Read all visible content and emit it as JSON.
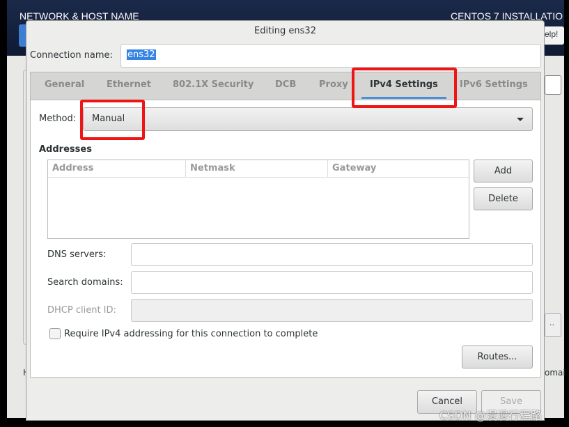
{
  "background": {
    "header_title": "NETWORK & HOST NAME",
    "header_right": "CENTOS 7 INSTALLATIO",
    "help_label": "elp!",
    "side_button_label": "..",
    "left_text": "H",
    "right_text": "omai"
  },
  "dialog": {
    "title": "Editing ens32",
    "connection_name_label": "Connection name:",
    "connection_name_value": "ens32",
    "tabs": [
      {
        "label": "General"
      },
      {
        "label": "Ethernet"
      },
      {
        "label": "802.1X Security"
      },
      {
        "label": "DCB"
      },
      {
        "label": "Proxy"
      },
      {
        "label": "IPv4 Settings",
        "active": true
      },
      {
        "label": "IPv6 Settings"
      }
    ],
    "method_label": "Method:",
    "method_value": "Manual",
    "addresses_label": "Addresses",
    "columns": [
      "Address",
      "Netmask",
      "Gateway"
    ],
    "add_label": "Add",
    "delete_label": "Delete",
    "dns_label": "DNS servers:",
    "dns_value": "",
    "search_label": "Search domains:",
    "search_value": "",
    "dhcp_label": "DHCP client ID:",
    "dhcp_value": "",
    "require_label": "Require IPv4 addressing for this connection to complete",
    "require_checked": false,
    "routes_label": "Routes...",
    "cancel_label": "Cancel",
    "save_label": "Save"
  },
  "watermark": "CSDN @漫漫行程路",
  "colors": {
    "accent": "#4a90d9",
    "highlight": "#f01515",
    "header": "#1b2a4a"
  }
}
